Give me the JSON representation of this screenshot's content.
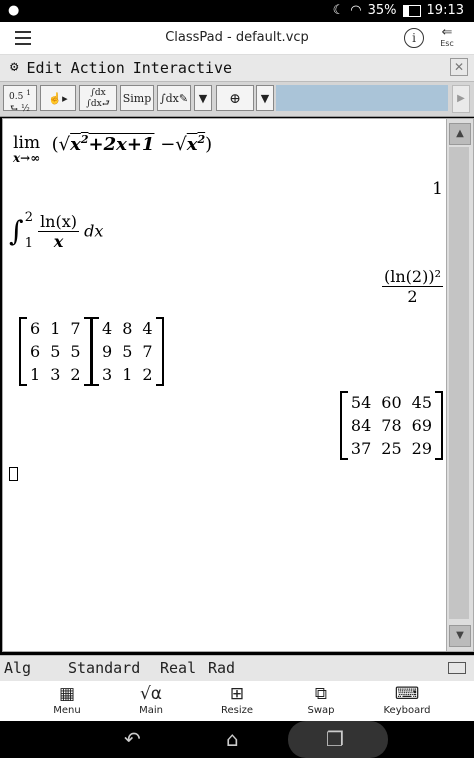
{
  "statusbar": {
    "battery": "35%",
    "time": "19:13"
  },
  "titlebar": {
    "title": "ClassPad - default.vcp",
    "esc_label": "Esc"
  },
  "menubar": {
    "items": [
      "Edit",
      "Action",
      "Interactive"
    ]
  },
  "toolbar": {
    "buttons": [
      "0.5 1/2",
      "hand",
      "∫dx ∫dx",
      "Simp",
      "∫dx",
      "▼",
      "graph",
      "▼"
    ]
  },
  "work": {
    "expr1": {
      "lim": "lim",
      "sub": "x→∞",
      "body": "(√x²+2x+1 − √x²)",
      "result": "1"
    },
    "expr2": {
      "upper": "2",
      "lower": "1",
      "num": "ln(x)",
      "den": "x",
      "dx": "dx",
      "result_num": "(ln(2))²",
      "result_den": "2"
    },
    "matrix_a": [
      [
        "6",
        "1",
        "7"
      ],
      [
        "6",
        "5",
        "5"
      ],
      [
        "1",
        "3",
        "2"
      ]
    ],
    "matrix_b": [
      [
        "4",
        "8",
        "4"
      ],
      [
        "9",
        "5",
        "7"
      ],
      [
        "3",
        "1",
        "2"
      ]
    ],
    "matrix_result": [
      [
        "54",
        "60",
        "45"
      ],
      [
        "84",
        "78",
        "69"
      ],
      [
        "37",
        "25",
        "29"
      ]
    ]
  },
  "statusline": {
    "mode": "Alg",
    "format": "Standard",
    "number": "Real",
    "angle": "Rad"
  },
  "appbar": {
    "items": [
      "Menu",
      "Main",
      "Resize",
      "Swap",
      "Keyboard"
    ]
  }
}
